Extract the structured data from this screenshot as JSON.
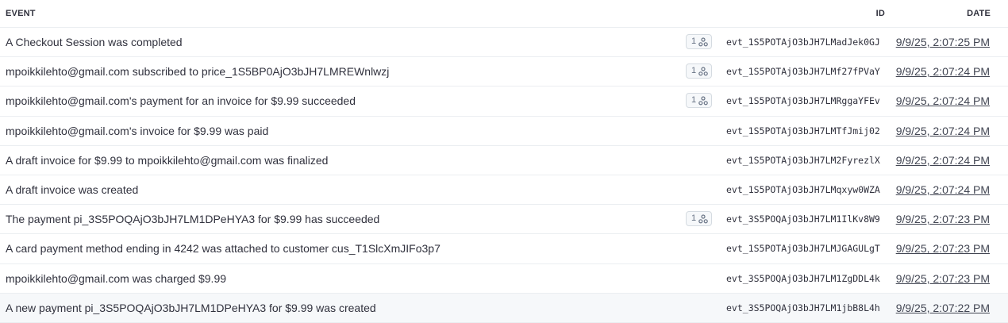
{
  "header": {
    "event": "EVENT",
    "id": "ID",
    "date": "DATE"
  },
  "rows": [
    {
      "description": "A Checkout Session was completed",
      "webhook_count": "1",
      "id": "evt_1S5POTAjO3bJH7LMadJek0GJ",
      "date": "9/9/25, 2:07:25 PM"
    },
    {
      "description": "mpoikkilehto@gmail.com subscribed to price_1S5BP0AjO3bJH7LMREWnlwzj",
      "webhook_count": "1",
      "id": "evt_1S5POTAjO3bJH7LMf27fPVaY",
      "date": "9/9/25, 2:07:24 PM"
    },
    {
      "description": "mpoikkilehto@gmail.com's payment for an invoice for $9.99 succeeded",
      "webhook_count": "1",
      "id": "evt_1S5POTAjO3bJH7LMRggaYFEv",
      "date": "9/9/25, 2:07:24 PM"
    },
    {
      "description": "mpoikkilehto@gmail.com's invoice for $9.99 was paid",
      "webhook_count": "",
      "id": "evt_1S5POTAjO3bJH7LMTfJmij02",
      "date": "9/9/25, 2:07:24 PM"
    },
    {
      "description": "A draft invoice for $9.99 to mpoikkilehto@gmail.com was finalized",
      "webhook_count": "",
      "id": "evt_1S5POTAjO3bJH7LM2FyrezlX",
      "date": "9/9/25, 2:07:24 PM"
    },
    {
      "description": "A draft invoice was created",
      "webhook_count": "",
      "id": "evt_1S5POTAjO3bJH7LMqxyw0WZA",
      "date": "9/9/25, 2:07:24 PM"
    },
    {
      "description": "The payment pi_3S5POQAjO3bJH7LM1DPeHYA3 for $9.99 has succeeded",
      "webhook_count": "1",
      "id": "evt_3S5POQAjO3bJH7LM1IlKv8W9",
      "date": "9/9/25, 2:07:23 PM"
    },
    {
      "description": "A card payment method ending in 4242 was attached to customer cus_T1SlcXmJIFo3p7",
      "webhook_count": "",
      "id": "evt_1S5POTAjO3bJH7LMJGAGULgT",
      "date": "9/9/25, 2:07:23 PM"
    },
    {
      "description": "mpoikkilehto@gmail.com was charged $9.99",
      "webhook_count": "",
      "id": "evt_3S5POQAjO3bJH7LM1ZgDDL4k",
      "date": "9/9/25, 2:07:23 PM"
    },
    {
      "description": "A new payment pi_3S5POQAjO3bJH7LM1DPeHYA3 for $9.99 was created",
      "webhook_count": "",
      "id": "evt_3S5POQAjO3bJH7LM1jbB8L4h",
      "date": "9/9/25, 2:07:22 PM"
    }
  ],
  "icons": {
    "webhook": "webhook-icon"
  }
}
